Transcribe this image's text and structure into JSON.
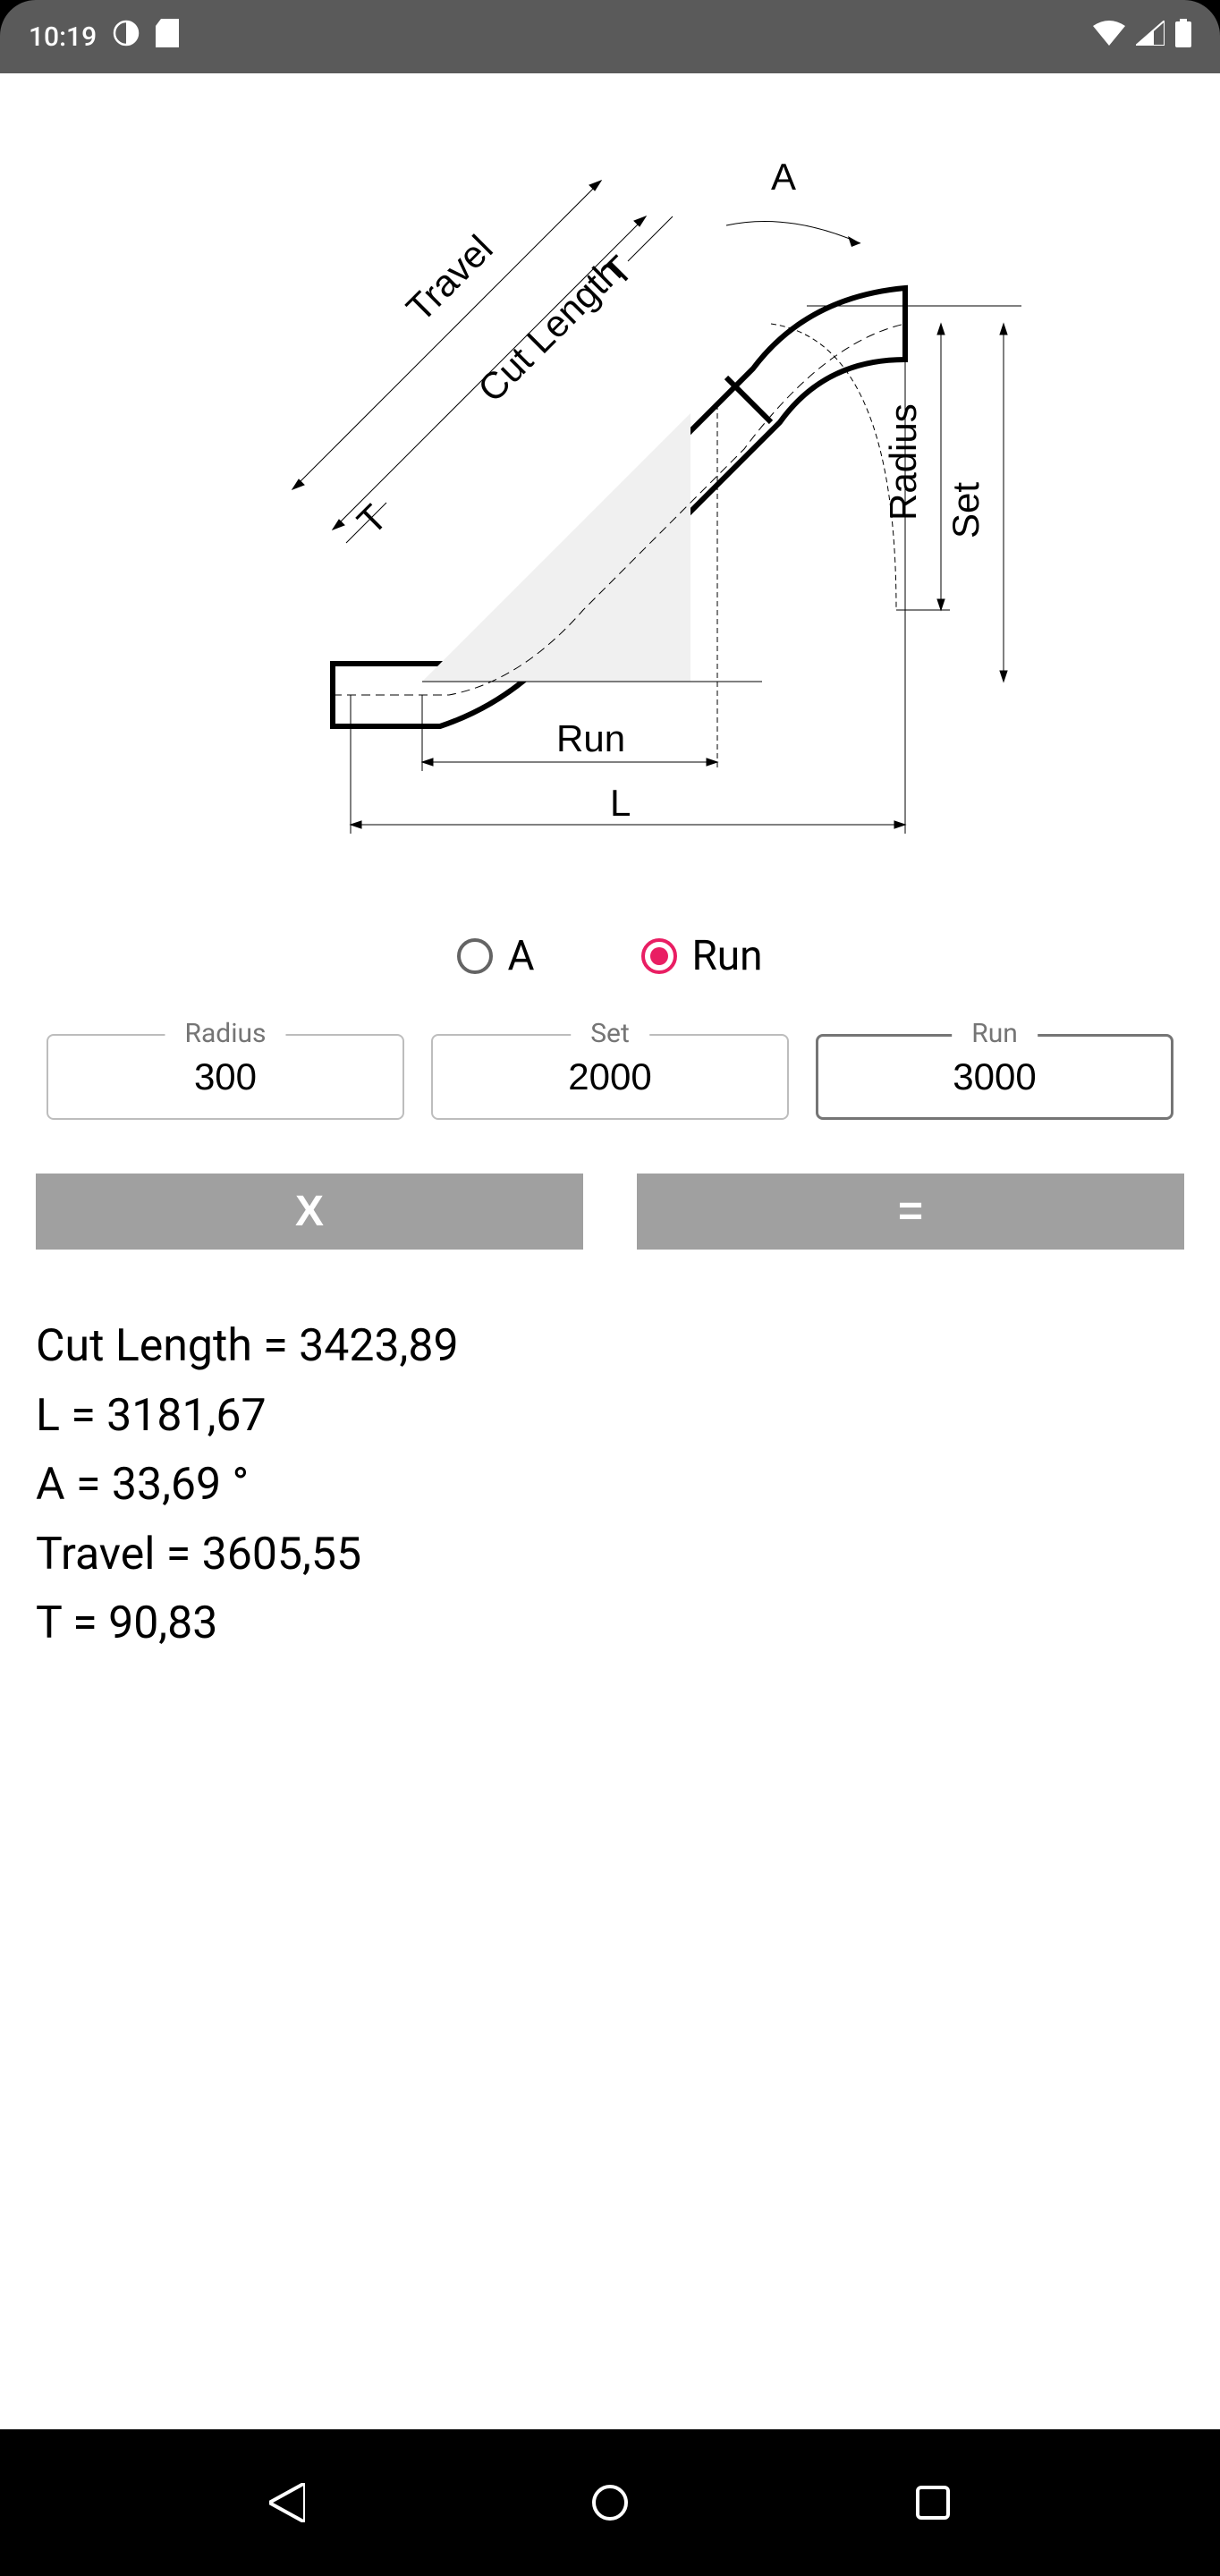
{
  "status": {
    "time": "10:19",
    "icons_left": [
      "contrast-icon",
      "sd-card-icon"
    ],
    "icons_right": [
      "wifi-icon",
      "signal-icon",
      "battery-icon"
    ]
  },
  "diagram": {
    "labels": {
      "travel": "Travel",
      "cut_length": "Cut Length",
      "t": "T",
      "a": "A",
      "radius": "Radius",
      "set": "Set",
      "run": "Run",
      "l": "L"
    }
  },
  "radios": {
    "a_label": "A",
    "run_label": "Run",
    "selected": "run"
  },
  "inputs": {
    "radius": {
      "label": "Radius",
      "value": "300"
    },
    "set": {
      "label": "Set",
      "value": "2000"
    },
    "run": {
      "label": "Run",
      "value": "3000"
    }
  },
  "buttons": {
    "clear": "X",
    "equals": "="
  },
  "results": {
    "cut_length": "Cut Length = 3423,89",
    "l": "L = 3181,67",
    "a": "A = 33,69 °",
    "travel": "Travel = 3605,55",
    "t": "T = 90,83"
  }
}
